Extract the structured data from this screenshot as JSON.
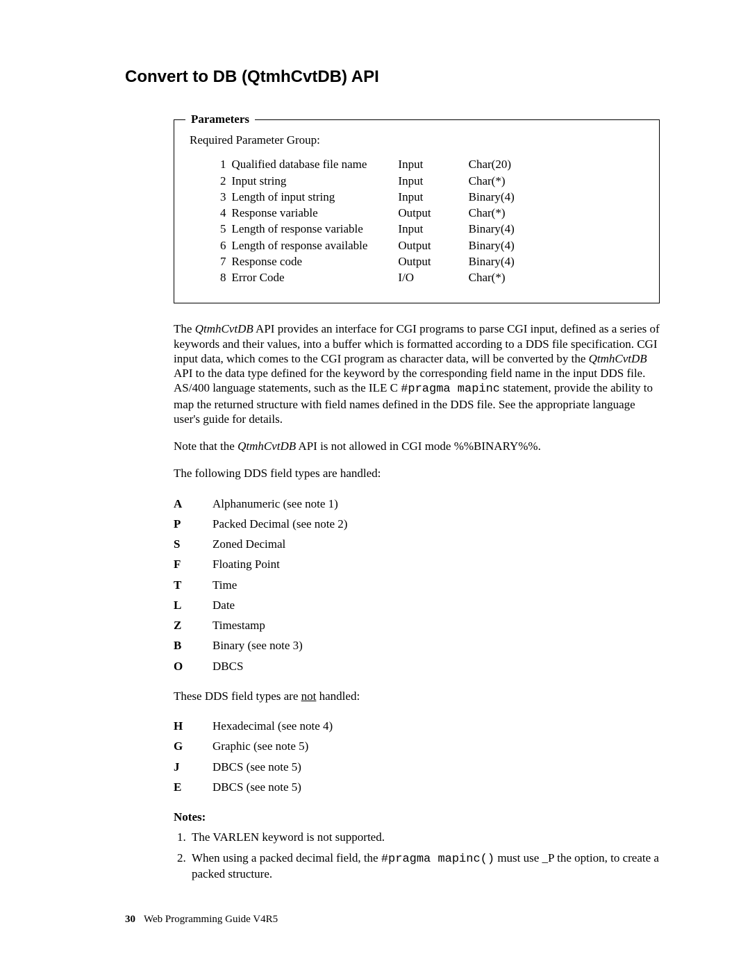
{
  "title": "Convert to DB (QtmhCvtDB) API",
  "params_legend": "Parameters",
  "rpg_label": "Required Parameter Group:",
  "params": [
    {
      "n": "1",
      "desc": "Qualified database file name",
      "dir": "Input",
      "type": "Char(20)"
    },
    {
      "n": "2",
      "desc": "Input string",
      "dir": "Input",
      "type": "Char(*)"
    },
    {
      "n": "3",
      "desc": "Length of input string",
      "dir": "Input",
      "type": "Binary(4)"
    },
    {
      "n": "4",
      "desc": "Response variable",
      "dir": "Output",
      "type": "Char(*)"
    },
    {
      "n": "5",
      "desc": "Length of response variable",
      "dir": "Input",
      "type": "Binary(4)"
    },
    {
      "n": "6",
      "desc": "Length of response available",
      "dir": "Output",
      "type": "Binary(4)"
    },
    {
      "n": "7",
      "desc": "Response code",
      "dir": "Output",
      "type": "Binary(4)"
    },
    {
      "n": "8",
      "desc": "Error Code",
      "dir": "I/O",
      "type": "Char(*)"
    }
  ],
  "para1_a": "The ",
  "para1_api": "QtmhCvtDB",
  "para1_b": " API provides an interface for CGI programs to parse CGI input, defined as a series of keywords and their values, into a buffer which is formatted according to a DDS file specification. CGI input data, which comes to the CGI program as character data, will be converted by the ",
  "para1_c": " API to the data type defined for the keyword by the corresponding field name in the input DDS file. AS/400 language statements, such as the ILE C ",
  "para1_code": "#pragma mapinc",
  "para1_d": " statement, provide the ability to map the returned structure with field names defined in the DDS file. See the appropriate language user's guide for details.",
  "para2_a": "Note that the ",
  "para2_api": "QtmhCvtDB",
  "para2_b": " API is not allowed in CGI mode %%BINARY%%.",
  "handled_intro": "The following DDS field types are handled:",
  "handled": [
    {
      "c": "A",
      "d": "Alphanumeric (see note 1)"
    },
    {
      "c": "P",
      "d": "Packed Decimal (see note 2)"
    },
    {
      "c": "S",
      "d": "Zoned Decimal"
    },
    {
      "c": "F",
      "d": "Floating Point"
    },
    {
      "c": "T",
      "d": "Time"
    },
    {
      "c": "L",
      "d": "Date"
    },
    {
      "c": "Z",
      "d": "Timestamp"
    },
    {
      "c": "B",
      "d": "Binary (see note 3)"
    },
    {
      "c": "O",
      "d": "DBCS"
    }
  ],
  "not_handled_a": "These DDS field types are ",
  "not_handled_u": "not",
  "not_handled_b": " handled:",
  "not_handled": [
    {
      "c": "H",
      "d": "Hexadecimal (see note 4)"
    },
    {
      "c": "G",
      "d": "Graphic (see note 5)"
    },
    {
      "c": "J",
      "d": "DBCS (see note 5)"
    },
    {
      "c": "E",
      "d": "DBCS (see note 5)"
    }
  ],
  "notes_label": "Notes:",
  "notes": {
    "n1": "The VARLEN keyword is not supported.",
    "n2a": "When using a packed decimal field, the ",
    "n2code": "#pragma mapinc()",
    "n2b": " must use _P the option, to create a packed structure."
  },
  "footer_page": "30",
  "footer_text": "Web Programming Guide V4R5"
}
